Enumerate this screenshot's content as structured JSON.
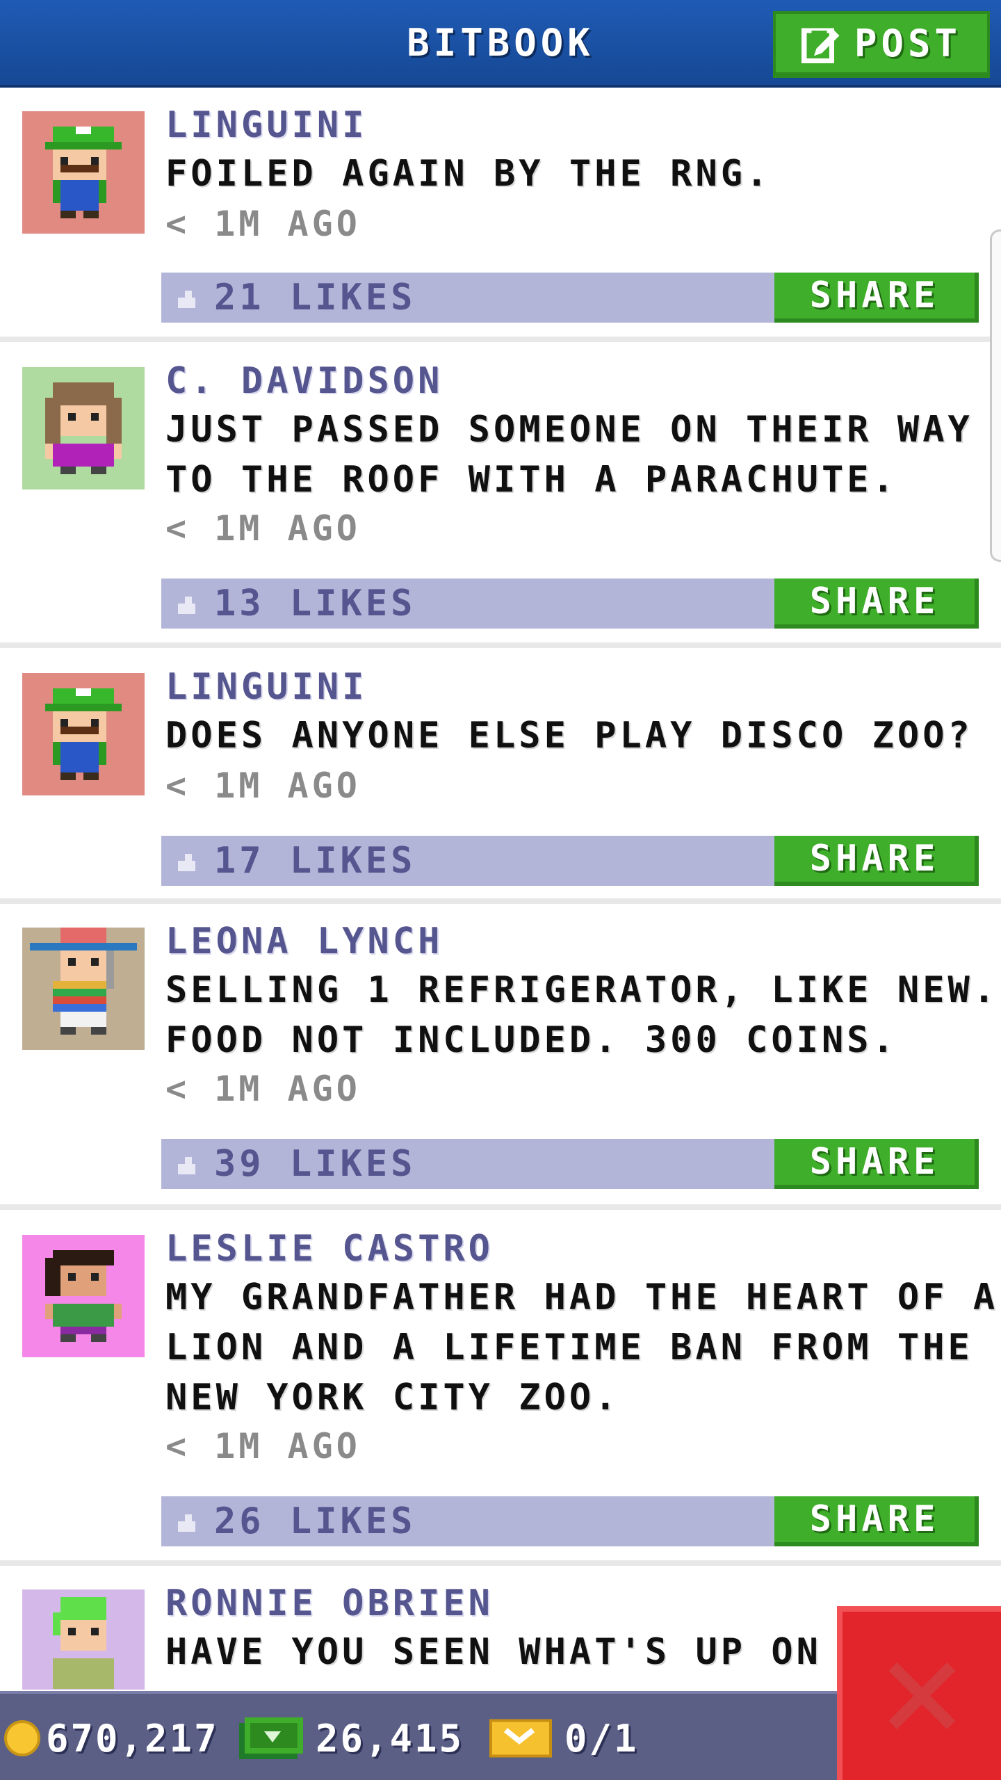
{
  "header": {
    "title": "BITBOOK",
    "post_label": "POST"
  },
  "posts": [
    {
      "author": "LINGUINI",
      "lines": [
        "FOILED AGAIN BY THE RNG."
      ],
      "time": "< 1M AGO",
      "likes": "21 LIKES",
      "share_label": "SHARE",
      "avatar": "plumber-green-cap",
      "avatar_bg": "#e08a82"
    },
    {
      "author": "C. DAVIDSON",
      "lines": [
        "JUST PASSED SOMEONE ON THEIR WAY",
        "TO THE ROOF WITH A PARACHUTE."
      ],
      "time": "< 1M AGO",
      "likes": "13 LIKES",
      "share_label": "SHARE",
      "avatar": "woman-purple-shirt",
      "avatar_bg": "#b0dba0"
    },
    {
      "author": "LINGUINI",
      "lines": [
        "DOES ANYONE ELSE PLAY DISCO ZOO?"
      ],
      "time": "< 1M AGO",
      "likes": "17 LIKES",
      "share_label": "SHARE",
      "avatar": "plumber-green-cap",
      "avatar_bg": "#e08a82"
    },
    {
      "author": "LEONA LYNCH",
      "lines": [
        "SELLING 1 REFRIGERATOR, LIKE NEW.",
        "FOOD NOT INCLUDED. 300 COINS."
      ],
      "time": "< 1M AGO",
      "likes": "39 LIKES",
      "share_label": "SHARE",
      "avatar": "sombrero-person",
      "avatar_bg": "#bfae92"
    },
    {
      "author": "LESLIE CASTRO",
      "lines": [
        "MY GRANDFATHER HAD THE HEART OF A",
        "LION AND A LIFETIME BAN FROM THE",
        "NEW YORK CITY ZOO."
      ],
      "time": "< 1M AGO",
      "likes": "26 LIKES",
      "share_label": "SHARE",
      "avatar": "woman-green-shirt",
      "avatar_bg": "#f587e8"
    },
    {
      "author": "RONNIE OBRIEN",
      "lines": [
        "HAVE YOU SEEN WHAT'S UP ON"
      ],
      "time": "",
      "likes": "",
      "share_label": "",
      "avatar": "green-hair-person",
      "avatar_bg": "#d5b8ea"
    }
  ],
  "bottom": {
    "coins": "670,217",
    "bux": "26,415",
    "vip": "0/1"
  },
  "icons": [
    "pencil-square-icon",
    "thumbs-up-icon",
    "coin-icon",
    "bux-icon",
    "vip-ticket-icon",
    "close-icon"
  ],
  "colors": {
    "header": "#1f5bb5",
    "accent_green": "#3fae2a",
    "likes_bar": "#b3b5d8",
    "author_text": "#55558f",
    "close_red": "#e2252a",
    "bottom_bar": "#5b5f86"
  }
}
